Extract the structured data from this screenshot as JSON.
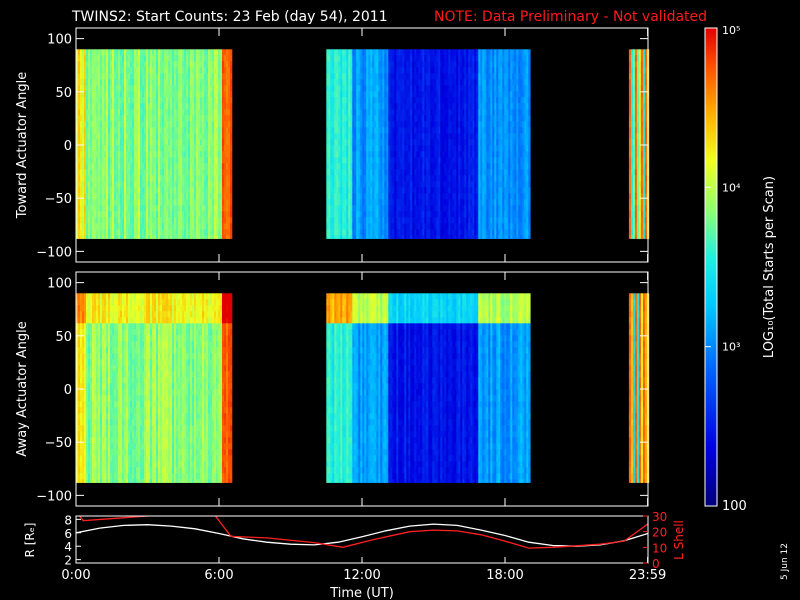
{
  "header": {
    "title": "TWINS2: Start Counts: 23 Feb (day  54), 2011",
    "note": "NOTE: Data Preliminary - Not validated",
    "note_color": "#ff1a1a"
  },
  "stamp": "5 Jun 12",
  "chart_data": [
    {
      "type": "heatmap",
      "panel": "toward",
      "ylabel": "Toward Actuator Angle",
      "ylim": [
        -110,
        110
      ],
      "yticks": [
        100,
        50,
        0,
        -50,
        -100
      ],
      "ytick_labels": [
        "100",
        "50",
        "0",
        "−50",
        "−100"
      ],
      "xlim_hours": [
        0,
        24
      ],
      "angle_range": [
        -88,
        90
      ],
      "data_segments": [
        {
          "start_h": 0.0,
          "end_h": 6.5,
          "log_level": 3.85
        },
        {
          "start_h": 10.5,
          "end_h": 19.0,
          "log_level": 2.75
        },
        {
          "start_h": 23.2,
          "end_h": 24.0,
          "log_level": 4.0
        }
      ]
    },
    {
      "type": "heatmap",
      "panel": "away",
      "ylabel": "Away Actuator Angle",
      "ylim": [
        -110,
        110
      ],
      "yticks": [
        100,
        50,
        0,
        -50,
        -100
      ],
      "ytick_labels": [
        "100",
        "50",
        "0",
        "−50",
        "−100"
      ],
      "xlim_hours": [
        0,
        24
      ],
      "angle_range": [
        -88,
        90
      ],
      "data_segments": [
        {
          "start_h": 0.0,
          "end_h": 6.5,
          "log_level": 3.85
        },
        {
          "start_h": 10.5,
          "end_h": 19.0,
          "log_level": 2.7
        },
        {
          "start_h": 23.2,
          "end_h": 24.0,
          "log_level": 4.0
        }
      ]
    },
    {
      "type": "colorbar",
      "label": "LOG₁₀(Total Starts per Scan)",
      "tick_labels": [
        "10⁵",
        "10⁴",
        "10³",
        "100"
      ],
      "tick_values": [
        5,
        4,
        3,
        2
      ],
      "range": [
        2,
        5
      ]
    },
    {
      "type": "line",
      "panel": "orbit",
      "xlabel": "Time (UT)",
      "xticks_h": [
        0,
        6,
        12,
        18,
        23.983
      ],
      "xtick_labels": [
        "0:00",
        "6:00",
        "12:00",
        "18:00",
        "23:59"
      ],
      "xlim_hours": [
        0,
        24
      ],
      "left_axis": {
        "label": "R [Rₑ]",
        "ylim": [
          1.5,
          8.5
        ],
        "ticks": [
          8,
          6,
          4,
          2
        ],
        "tick_labels": [
          "8",
          "6",
          "4",
          "2"
        ]
      },
      "right_axis": {
        "label": "L Shell",
        "ylim": [
          0,
          30
        ],
        "ticks": [
          30,
          20,
          10,
          0
        ],
        "tick_labels": [
          "30",
          "20",
          "10",
          "0"
        ],
        "color": "#ff2020"
      },
      "series": [
        {
          "name": "R",
          "axis": "left",
          "color": "#ffffff",
          "x": [
            0,
            1,
            2,
            3,
            4,
            5,
            6,
            6.5,
            7,
            8,
            9,
            10,
            11,
            12,
            13,
            14,
            15,
            16,
            17,
            18,
            19,
            20,
            21,
            22,
            23,
            24
          ],
          "y": [
            6.0,
            6.7,
            7.1,
            7.2,
            7.0,
            6.6,
            5.9,
            5.5,
            5.1,
            4.6,
            4.3,
            4.2,
            4.6,
            5.4,
            6.3,
            7.0,
            7.3,
            7.1,
            6.4,
            5.6,
            4.6,
            4.1,
            4.0,
            4.2,
            4.8,
            5.9
          ]
        },
        {
          "name": "L Shell",
          "axis": "right",
          "color": "#ff2020",
          "x": [
            0,
            0.3,
            5.7,
            6.5,
            8,
            10,
            11.2,
            12.5,
            14,
            15,
            16,
            17,
            18,
            19,
            20,
            21,
            22,
            23,
            24
          ],
          "y": [
            33,
            27,
            33,
            17,
            16,
            13,
            10,
            15,
            20,
            21,
            20.5,
            18,
            14,
            9.5,
            10,
            11,
            12,
            14,
            25
          ]
        }
      ]
    }
  ]
}
